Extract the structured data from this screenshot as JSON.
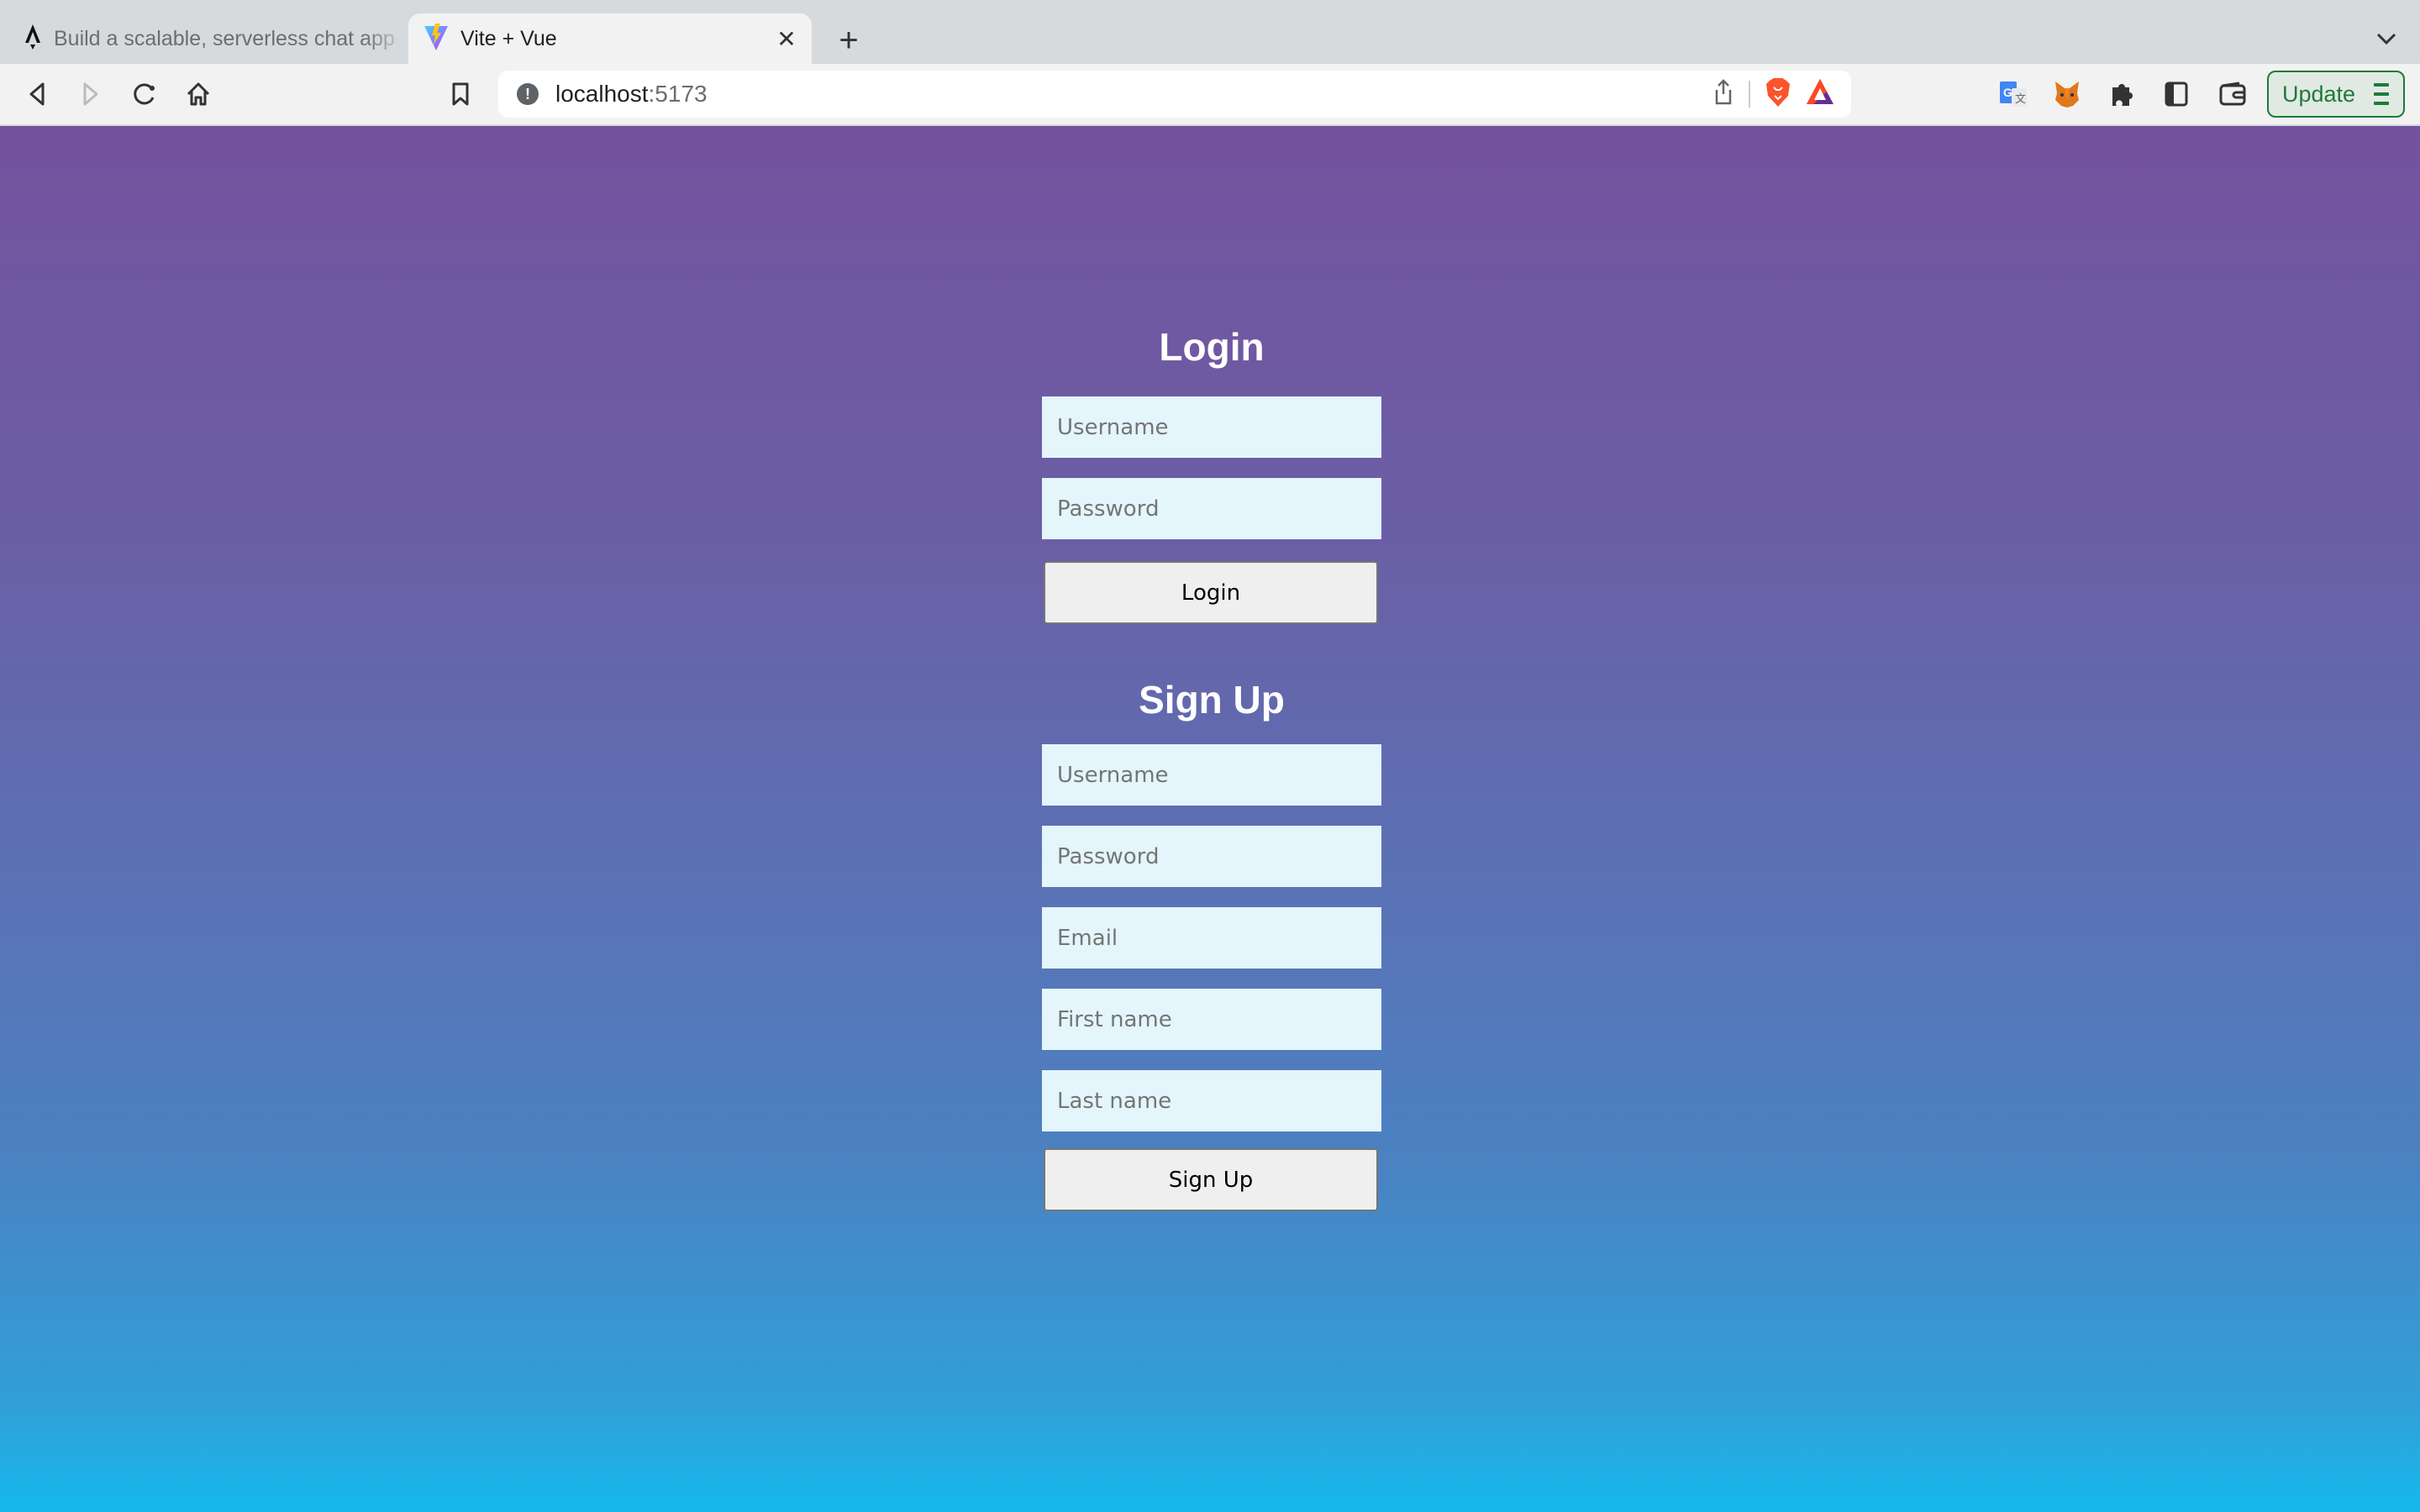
{
  "browser": {
    "tabs": [
      {
        "title": "Build a scalable, serverless chat app",
        "icon": "amplify-icon",
        "active": false
      },
      {
        "title": "Vite + Vue",
        "icon": "vite-icon",
        "active": true
      }
    ],
    "close_tab_glyph": "✕",
    "new_tab_glyph": "+",
    "address": {
      "host": "localhost",
      "port": ":5173",
      "info_glyph": "!"
    },
    "update_label": "Update"
  },
  "login": {
    "title": "Login",
    "username_placeholder": "Username",
    "password_placeholder": "Password",
    "submit_label": "Login"
  },
  "signup": {
    "title": "Sign Up",
    "username_placeholder": "Username",
    "password_placeholder": "Password",
    "email_placeholder": "Email",
    "first_name_placeholder": "First name",
    "last_name_placeholder": "Last name",
    "submit_label": "Sign Up"
  },
  "colors": {
    "gradient_top": "#74529e",
    "gradient_bottom": "#16b8ec",
    "input_bg": "#e4f5fc",
    "update_green": "#1e7a3a"
  }
}
